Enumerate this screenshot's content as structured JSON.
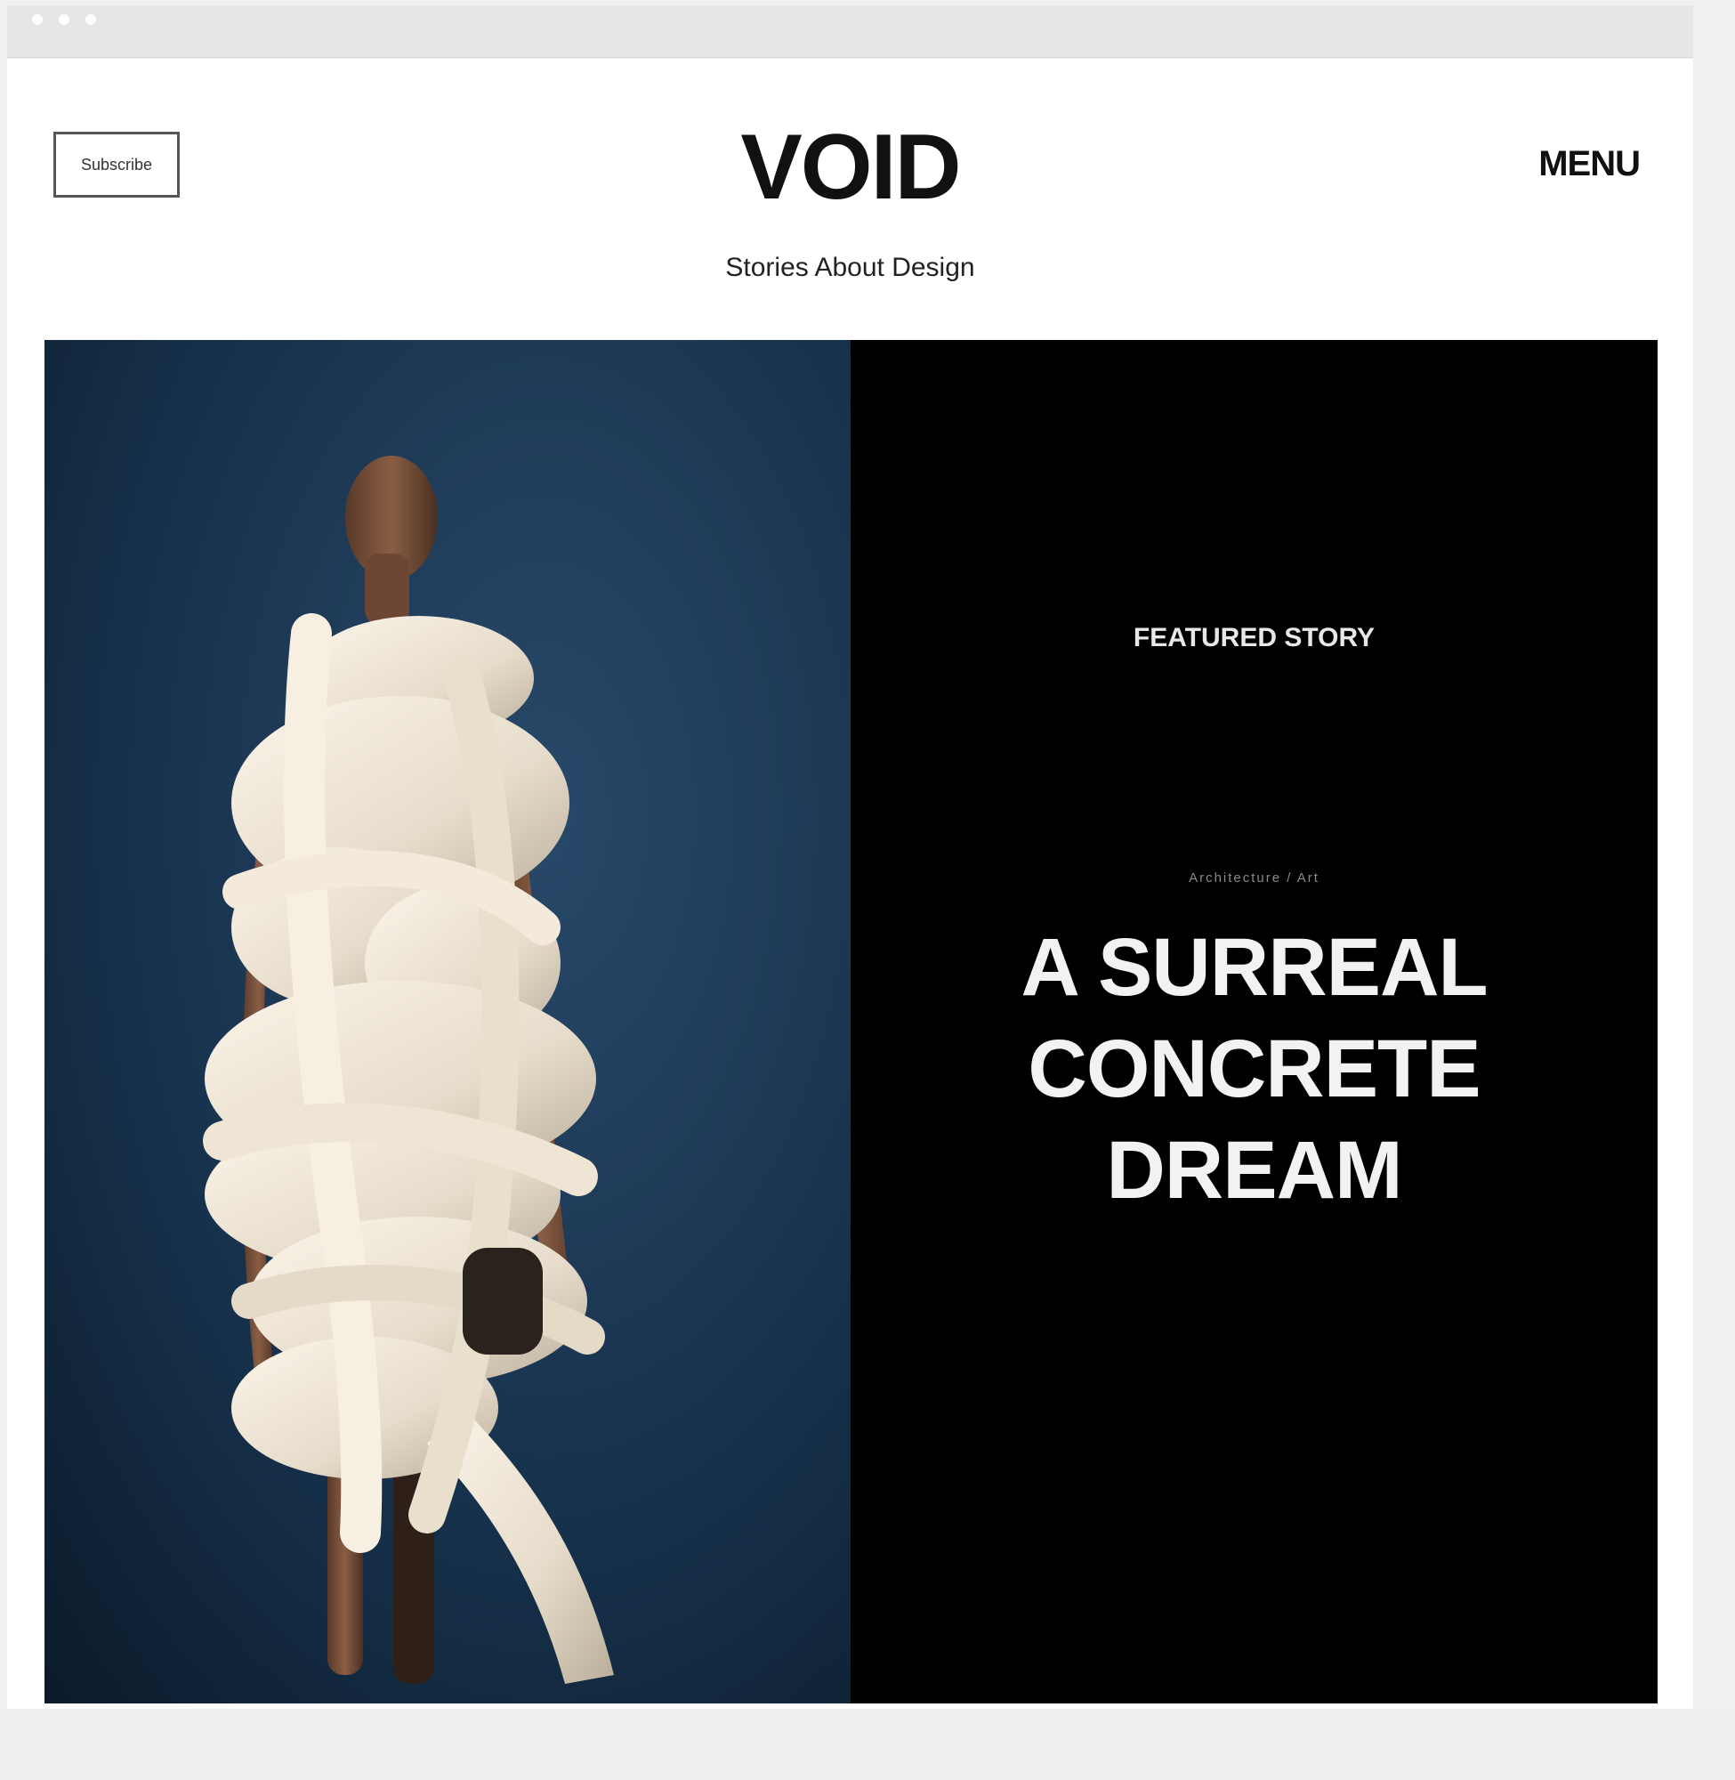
{
  "header": {
    "subscribe_label": "Subscribe",
    "logo": "VOID",
    "menu_label": "MENU",
    "tagline": "Stories About Design"
  },
  "hero": {
    "image_alt": "Person wrapped in large cream-colored knotted tubes against a dark blue backdrop",
    "featured_label": "FEATURED STORY",
    "meta": "Architecture / Art",
    "title_lines": [
      "A SURREAL",
      "CONCRETE",
      "DREAM"
    ]
  },
  "colors": {
    "hero_text_bg": "#000000",
    "image_backdrop": "#1c3550",
    "knot_cream": "#efe6d8"
  }
}
